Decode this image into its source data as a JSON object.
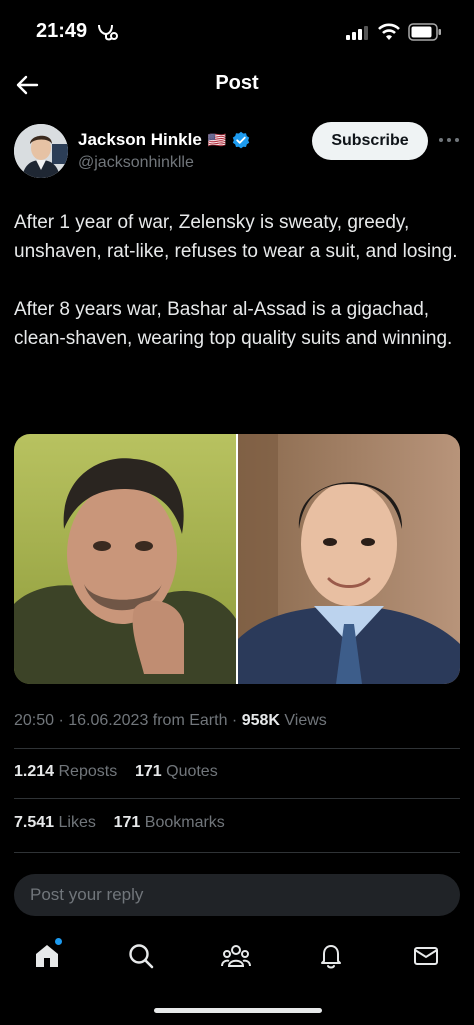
{
  "status_bar": {
    "time": "21:49"
  },
  "header": {
    "title": "Post"
  },
  "author": {
    "name": "Jackson Hinkle",
    "handle": "@jacksonhinklle",
    "flag": "🇺🇸",
    "verified_color": "#1d9bf0"
  },
  "subscribe_label": "Subscribe",
  "post": {
    "paragraphs": [
      "After 1 year of war, Zelensky is sweaty, greedy, unshaven, rat-like, refuses to wear a suit, and losing.",
      "After 8 years war, Bashar al-Assad is a gigachad, clean-shaven, wearing top quality suits and winning."
    ],
    "timestamp": "20:50 · 16.06.2023 from Earth · ",
    "views_count": "958K",
    "views_label": " Views"
  },
  "stats": {
    "reposts_count": "1.214",
    "reposts_label": " Reposts",
    "quotes_count": "171",
    "quotes_label": " Quotes",
    "likes_count": "7.541",
    "likes_label": " Likes",
    "bookmarks_count": "171",
    "bookmarks_label": " Bookmarks"
  },
  "reply": {
    "placeholder": "Post your reply"
  },
  "tabs": [
    {
      "icon": "home-icon"
    },
    {
      "icon": "search-icon"
    },
    {
      "icon": "communities-icon"
    },
    {
      "icon": "notifications-icon"
    },
    {
      "icon": "messages-icon"
    }
  ],
  "colors": {
    "background": "#000000",
    "accent": "#1d9bf0",
    "muted": "#71767b",
    "text": "#e7e9ea"
  }
}
